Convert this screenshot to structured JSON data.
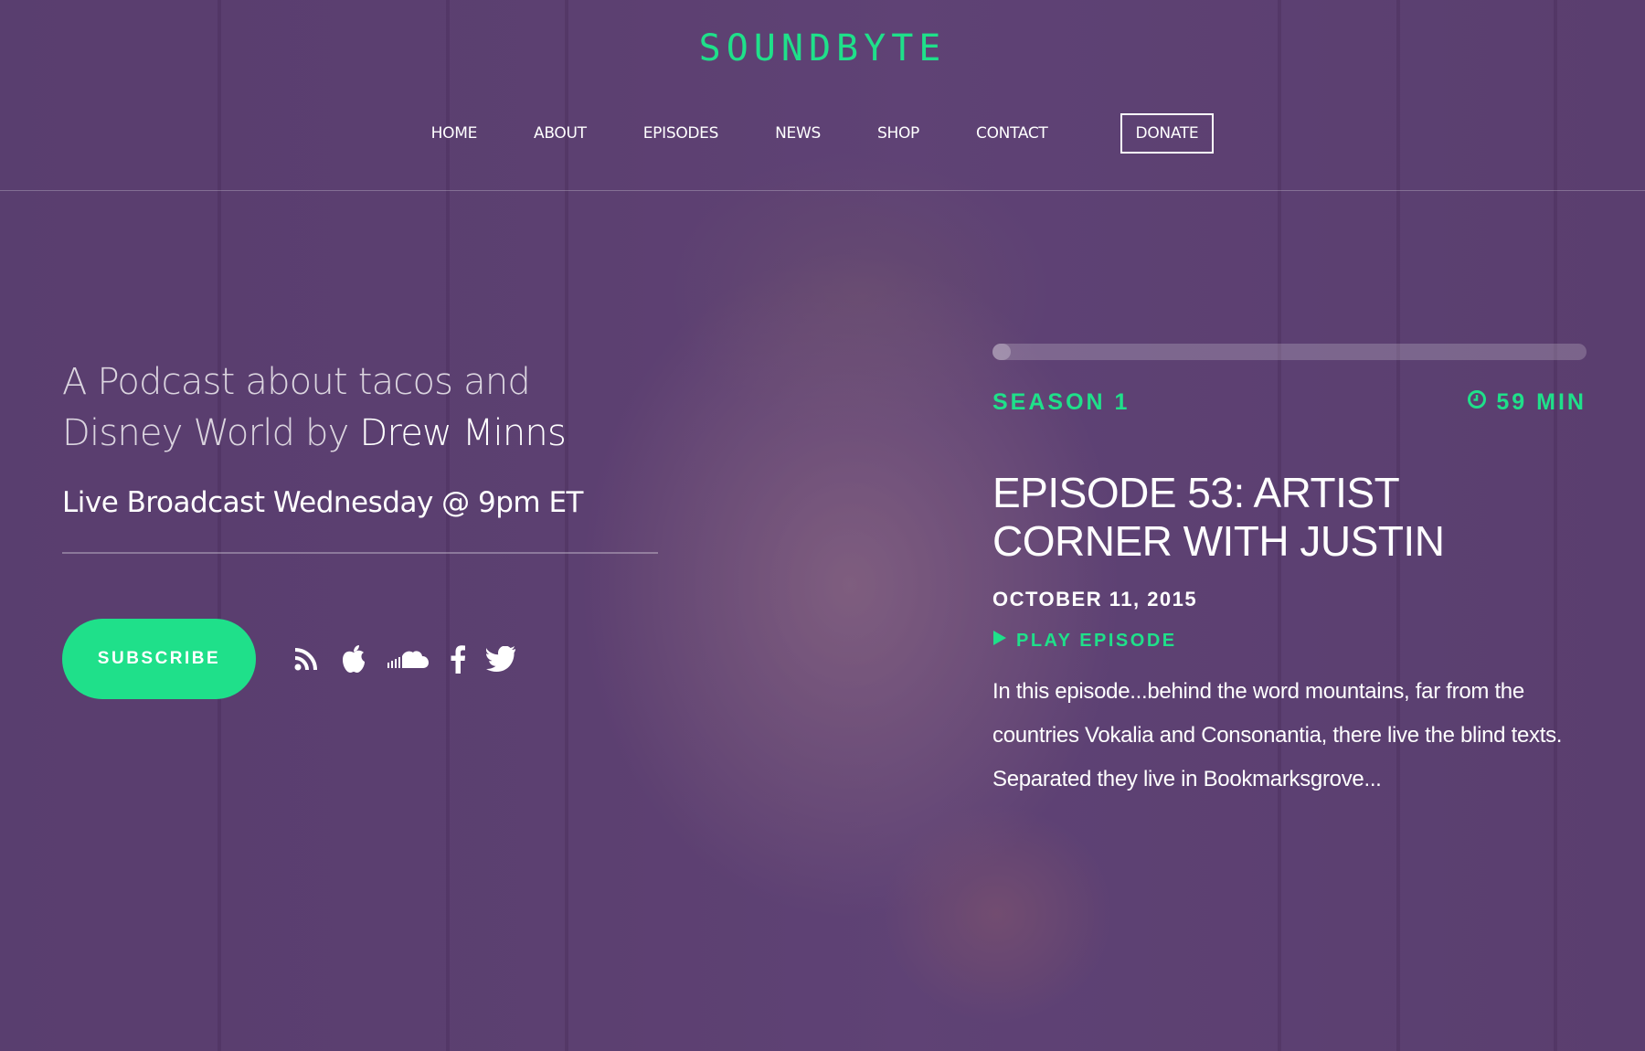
{
  "brand": {
    "logo": "SOUNDBYTE",
    "accent": "#1fe08a"
  },
  "nav": {
    "items": [
      "HOME",
      "ABOUT",
      "EPISODES",
      "NEWS",
      "SHOP",
      "CONTACT"
    ],
    "donate": "DONATE"
  },
  "hero": {
    "tagline_lead": "A Podcast about tacos and Disney World by",
    "author": "Drew Minns",
    "live": "Live Broadcast Wednesday @ 9pm ET",
    "subscribe": "SUBSCRIBE",
    "social_icons": [
      "rss-icon",
      "apple-icon",
      "soundcloud-icon",
      "facebook-icon",
      "twitter-icon"
    ]
  },
  "episode": {
    "progress": 0.03,
    "season": "SEASON 1",
    "duration": "59 MIN",
    "title": "EPISODE 53: ARTIST CORNER WITH JUSTIN",
    "date": "OCTOBER 11, 2015",
    "play": "PLAY EPISODE",
    "description": "In this episode...behind the word mountains, far from the countries Vokalia and Consonantia, there live the blind texts. Separated they live in Bookmarksgrove..."
  }
}
